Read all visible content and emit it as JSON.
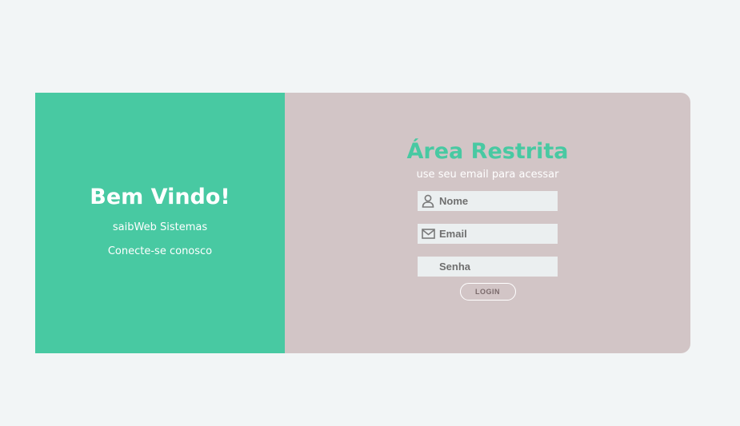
{
  "welcome": {
    "title": "Bem Vindo!",
    "company": "saibWeb Sistemas",
    "tagline": "Conecte-se conosco"
  },
  "login_panel": {
    "title": "Área Restrita",
    "subtitle": "use seu email para acessar",
    "fields": {
      "name_placeholder": "Nome",
      "email_placeholder": "Email",
      "password_placeholder": "Senha"
    },
    "button_label": "LOGIN"
  },
  "icons": {
    "name": "user-icon",
    "email": "envelope-icon"
  },
  "colors": {
    "background": "#f2f5f6",
    "accent": "#48c9a2",
    "panel": "#d2c5c6",
    "field": "#ebeff0"
  }
}
